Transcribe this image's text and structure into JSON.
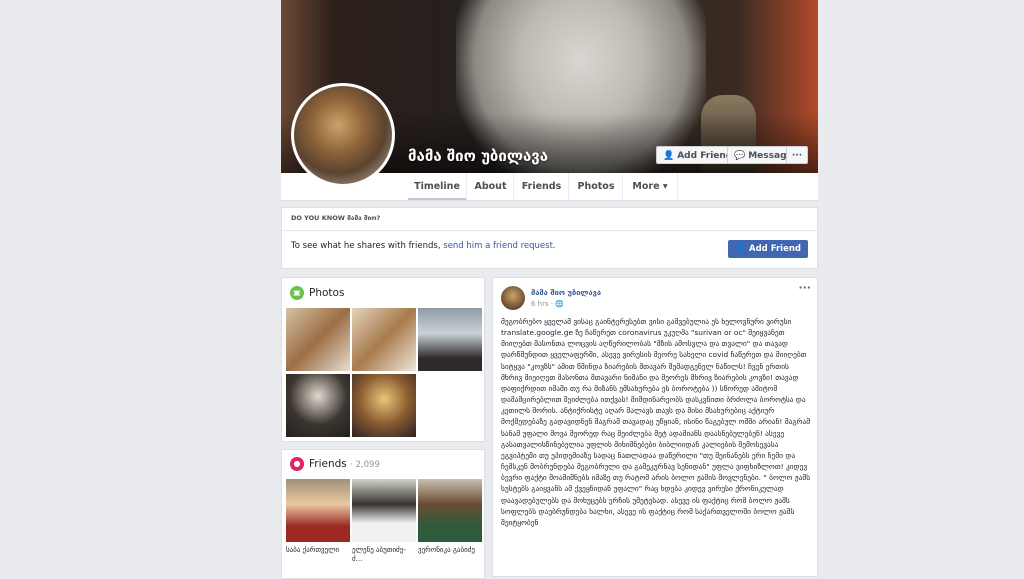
{
  "profile": {
    "name": "მამა შიო უბილავა",
    "buttons": {
      "add_friend": "Add Friend",
      "message": "Message",
      "more": "···"
    }
  },
  "tabs": [
    "Timeline",
    "About",
    "Friends",
    "Photos",
    "More ▾"
  ],
  "know_box": {
    "heading": "DO YOU KNOW მამა შიო?",
    "text": "To see what he shares with friends, ",
    "link": "send him a friend request.",
    "button": "Add Friend"
  },
  "photos": {
    "title": "Photos"
  },
  "friends": {
    "title": "Friends",
    "count": "· 2,099",
    "items": [
      {
        "name": "საბა ქართველი"
      },
      {
        "name": "ელენე აბუთიძე-ძ..."
      },
      {
        "name": "ვერონიკა გაბიძე"
      }
    ]
  },
  "post": {
    "author": "მამა შიო უბილავა",
    "time": "6 hrs · ",
    "more": "···",
    "body": "მეგობრებო ყველამ ვისაც გაინტერესებთ ვისი გამვებულია ეს ხელოვნური ვირუსი translate.google.ge ზე ჩაწერეთ coronavirus უკუღმა \"surivan or oc\" შეიყვანეთ მიიღებთ მასონთა ლოცვის აღწერილობას \"მზის ამოსვლა და თვალი\" და თავად დარწმუნდით ყველაფერში, ასევე ვირუსის მეორე სახელი covid ჩაწერეთ და მიიღებთ სიტყვა \"კოვზს\" ამით წმინდა ზიარების მთავარ შემადგენელ ნაწილს! ჩვენ ერთის მხრივ მიეიღეთ მასონთა მთავარი ნიშანი და მეორეს მხრივ ზიარების კოვზი! თავად დაფიქრდით იმაში თუ რა მიზანს ემსახურება ეს ბოროტება )) სწორედ ამიტომ დამამცირებლით შეიძლება ითქვას! მიმდინარეობს დასკვნითი ბრძოლა ბოროტსა და კეთილს შორის. ანტიქრისტე აღარ მალავს თავს და მისი მსახურებიც აქტიურ მოქმედებაზე გადავიდნენ მაგრამ თავადაც უწყიან, ისინი წაგებულ ომში არიან! მაგრამ სანამ უფალი მოვა მეორედ რაც შეიძლება მეტ ადამიანს დაასნებულებენ! ასევე გასათვალისწინებელია უფლის მიხიშნებები ბიბლიიდან კალიების შემოსევასა ეგვიპტეში თუ ეპიდემიაზე სადაც ნათლადაა დაწერილი \"თუ შეინანებს ერი ჩემი და ჩემსკენ მობრუნდება მეგობრული და გამეკურნავ სენიდან\" უფლა ვიფხიზლოთ! კიდევ ბევრი ფაქტი მოამიშნებს იმაზე თუ რატომ არის ბოლო ჟამის მოვლენები. \" ბოლო ჟამს სუსტებს გაიყვანს ამ ქვეყნიდან უფალი\" რაც ხდება კიდევ ვირუსი ქრონიკულად დაავადებულებს და მოხუცებს ერჩის უმეტესად. ასევე ის ფაქტიც რომ ბოლო ჟამს სოფლებს დაუბრუნდება ხალხი, ასევე ის ფაქტიც რომ საქართველოში ბოლო ჟამს შეიტყობენ"
  },
  "colors": {
    "page_bg": "#e9ebee",
    "link": "#365899",
    "button_blue": "#4267b2"
  }
}
